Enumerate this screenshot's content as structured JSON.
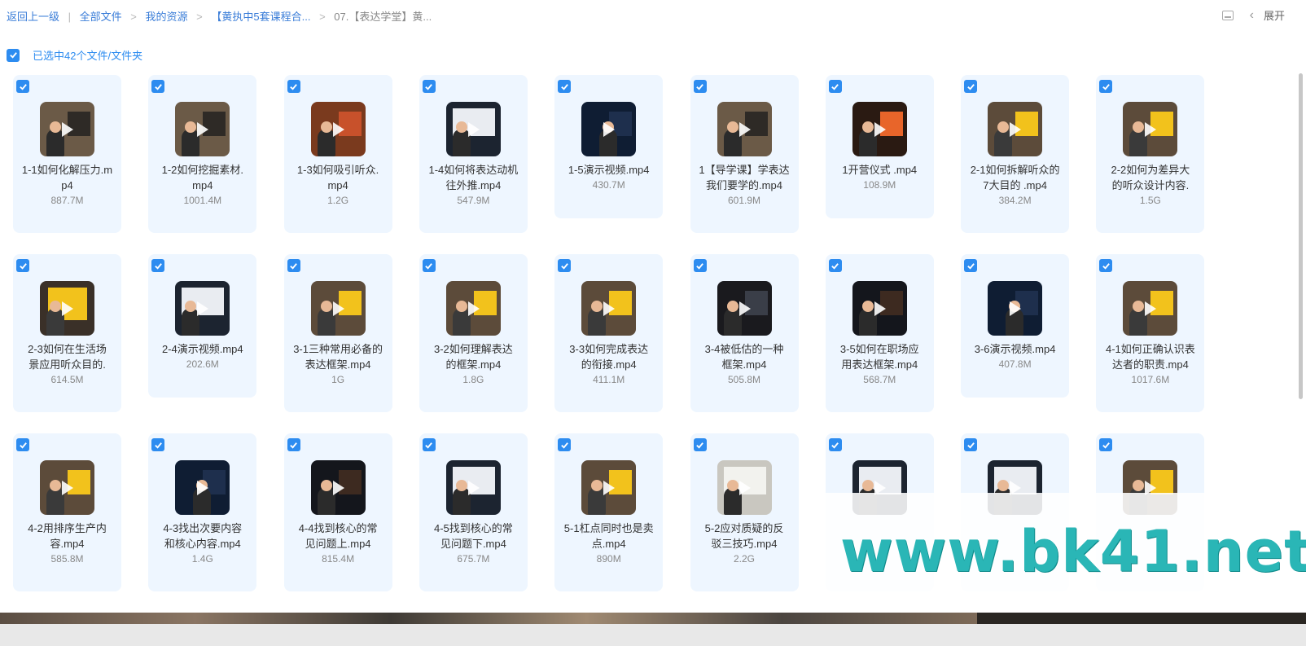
{
  "breadcrumb": {
    "back": "返回上一级",
    "items": [
      "全部文件",
      "我的资源",
      "【黄执中5套课程合...",
      "07.【表达学堂】黄..."
    ]
  },
  "toolbar": {
    "expand_label": "展开"
  },
  "selection": {
    "text": "已选中42个文件/文件夹"
  },
  "watermark": "www.bk41.net",
  "files": [
    {
      "name": "1-1如何化解压力.mp4",
      "size": "887.7M",
      "theme": "studio"
    },
    {
      "name": "1-2如何挖掘素材.mp4",
      "size": "1001.4M",
      "theme": "studio"
    },
    {
      "name": "1-3如何吸引听众.mp4",
      "size": "1.2G",
      "theme": "portrait"
    },
    {
      "name": "1-4如何将表达动机往外推.mp4",
      "size": "547.9M",
      "theme": "slide"
    },
    {
      "name": "1-5演示视频.mp4",
      "size": "430.7M",
      "theme": "stage"
    },
    {
      "name": "1【导学课】学表达我们要学的.mp4",
      "size": "601.9M",
      "theme": "studio"
    },
    {
      "name": "1开营仪式 .mp4",
      "size": "108.9M",
      "theme": "orange"
    },
    {
      "name": "2-1如何拆解听众的7大目的 .mp4",
      "size": "384.2M",
      "theme": "yellow"
    },
    {
      "name": "2-2如何为差异大的听众设计内容.",
      "size": "1.5G",
      "theme": "yellow"
    },
    {
      "name": "2-3如何在生活场景应用听众目的.",
      "size": "614.5M",
      "theme": "yellowbig"
    },
    {
      "name": "2-4演示视频.mp4",
      "size": "202.6M",
      "theme": "slide"
    },
    {
      "name": "3-1三种常用必备的表达框架.mp4",
      "size": "1G",
      "theme": "yellow"
    },
    {
      "name": "3-2如何理解表达的框架.mp4",
      "size": "1.8G",
      "theme": "yellow"
    },
    {
      "name": "3-3如何完成表达的衔接.mp4",
      "size": "411.1M",
      "theme": "yellow"
    },
    {
      "name": "3-4被低估的一种框架.mp4",
      "size": "505.8M",
      "theme": "dark"
    },
    {
      "name": "3-5如何在职场应用表达框架.mp4",
      "size": "568.7M",
      "theme": "darkorange"
    },
    {
      "name": "3-6演示视频.mp4",
      "size": "407.8M",
      "theme": "stage"
    },
    {
      "name": "4-1如何正确认识表达者的职责.mp4",
      "size": "1017.6M",
      "theme": "yellow"
    },
    {
      "name": "4-2用排序生产内容.mp4",
      "size": "585.8M",
      "theme": "yellow"
    },
    {
      "name": "4-3找出次要内容和核心内容.mp4",
      "size": "1.4G",
      "theme": "stage"
    },
    {
      "name": "4-4找到核心的常见问题上.mp4",
      "size": "815.4M",
      "theme": "darkorange"
    },
    {
      "name": "4-5找到核心的常见问题下.mp4",
      "size": "675.7M",
      "theme": "slide"
    },
    {
      "name": "5-1杠点同时也是卖点.mp4",
      "size": "890M",
      "theme": "yellow"
    },
    {
      "name": "5-2应对质疑的反驳三技巧.mp4",
      "size": "2.2G",
      "theme": "board"
    },
    {
      "name": "",
      "size": "",
      "theme": "slide"
    },
    {
      "name": "",
      "size": "",
      "theme": "slide"
    },
    {
      "name": "",
      "size": "",
      "theme": "yellow"
    }
  ],
  "name_lines": [
    [
      "1-1如何化解压力.m",
      "p4"
    ],
    [
      "1-2如何挖掘素材.",
      "mp4"
    ],
    [
      "1-3如何吸引听众.",
      "mp4"
    ],
    [
      "1-4如何将表达动机",
      "往外推.mp4"
    ],
    [
      "1-5演示视频.mp4"
    ],
    [
      "1【导学课】学表达",
      "我们要学的.mp4"
    ],
    [
      "1开营仪式 .mp4"
    ],
    [
      "2-1如何拆解听众的",
      "7大目的 .mp4"
    ],
    [
      "2-2如何为差异大",
      "的听众设计内容."
    ],
    [
      "2-3如何在生活场",
      "景应用听众目的."
    ],
    [
      "2-4演示视频.mp4"
    ],
    [
      "3-1三种常用必备的",
      "表达框架.mp4"
    ],
    [
      "3-2如何理解表达",
      "的框架.mp4"
    ],
    [
      "3-3如何完成表达",
      "的衔接.mp4"
    ],
    [
      "3-4被低估的一种",
      "框架.mp4"
    ],
    [
      "3-5如何在职场应",
      "用表达框架.mp4"
    ],
    [
      "3-6演示视频.mp4"
    ],
    [
      "4-1如何正确认识表",
      "达者的职责.mp4"
    ],
    [
      "4-2用排序生产内",
      "容.mp4"
    ],
    [
      "4-3找出次要内容",
      "和核心内容.mp4"
    ],
    [
      "4-4找到核心的常",
      "见问题上.mp4"
    ],
    [
      "4-5找到核心的常",
      "见问题下.mp4"
    ],
    [
      "5-1杠点同时也是卖",
      "点.mp4"
    ],
    [
      "5-2应对质疑的反",
      "驳三技巧.mp4"
    ],
    [],
    [],
    []
  ],
  "colors": {
    "accent": "#2d8cf0",
    "card_bg": "#eef6ff",
    "watermark": "#2ab6b6"
  }
}
